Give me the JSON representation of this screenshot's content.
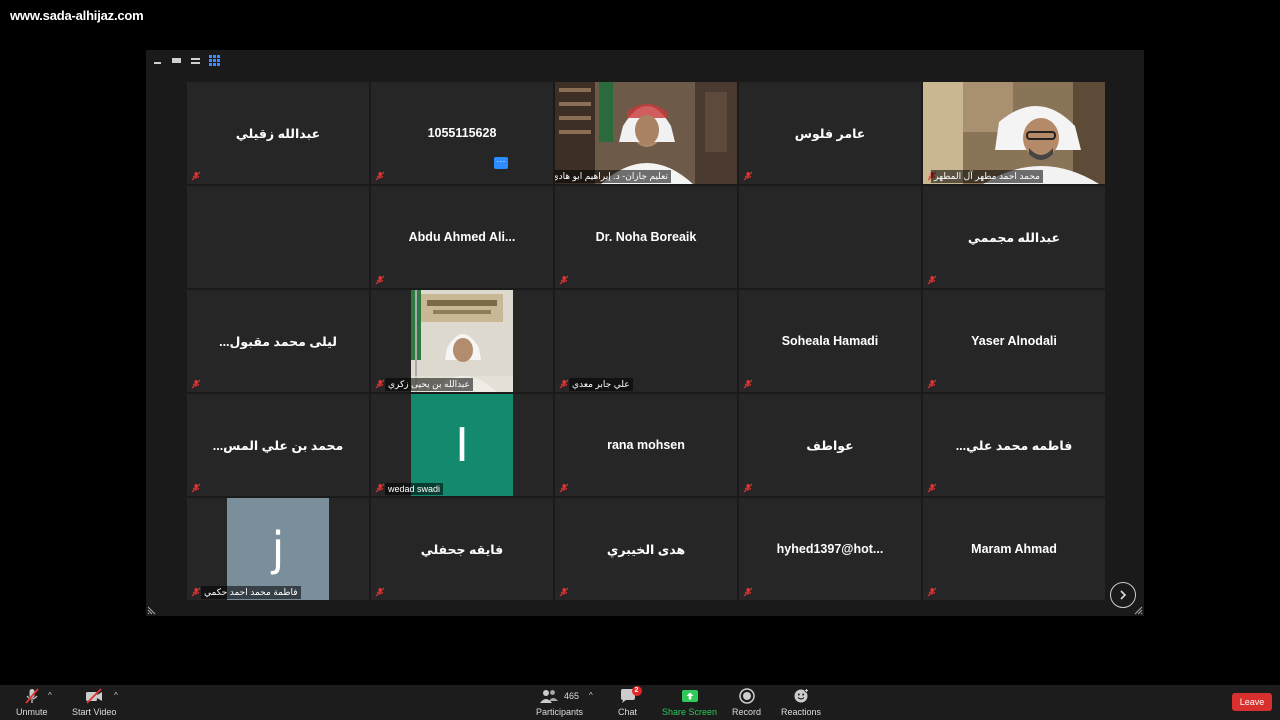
{
  "watermark": "www.sada-alhijaz.com",
  "tiles": [
    {
      "name": "عبدالله زقيلي",
      "muted": true
    },
    {
      "name": "1055115628",
      "muted": true
    },
    {
      "caption": "تعليم جازان- د. إبراهيم ابو هادي",
      "muted": false,
      "video": true
    },
    {
      "name": "عامر فلوس",
      "muted": true
    },
    {
      "caption": "محمد احمد مطهر آل المطهر",
      "muted": true,
      "video": true
    },
    {
      "name": "",
      "muted": false
    },
    {
      "name": "Abdu  Ahmed  Ali...",
      "muted": true
    },
    {
      "name": "Dr. Noha Boreaik",
      "muted": true
    },
    {
      "name": "",
      "muted": false
    },
    {
      "name": "عبدالله مجممي",
      "muted": true
    },
    {
      "name": "ليلى محمد مقبول...",
      "muted": true
    },
    {
      "caption": "عبدالله بن يحيى زكري",
      "muted": true,
      "video": true
    },
    {
      "caption": "علي جابر معدي",
      "muted": true
    },
    {
      "name": "Soheala Hamadi",
      "muted": true
    },
    {
      "name": "Yaser Alnodali",
      "muted": true
    },
    {
      "name": "محمد بن علي المس...",
      "muted": true
    },
    {
      "caption": "wedad swadi",
      "muted": true,
      "avatar": "I"
    },
    {
      "name": "rana mohsen",
      "muted": true
    },
    {
      "name": "عواطف",
      "muted": true
    },
    {
      "name": "فاطمه محمد علي...",
      "muted": true
    },
    {
      "caption": "فاطمة محمد احمد حكمي",
      "muted": true,
      "avatar": "j"
    },
    {
      "name": "فايقه جحفلي",
      "muted": true
    },
    {
      "name": "هدى الخيبري",
      "muted": true
    },
    {
      "name": "hyhed1397@hot...",
      "muted": true
    },
    {
      "name": "Maram Ahmad",
      "muted": true
    }
  ],
  "toolbar": {
    "unmute": "Unmute",
    "start_video": "Start Video",
    "participants": "Participants",
    "participants_count": "465",
    "chat": "Chat",
    "chat_badge": "2",
    "share_screen": "Share Screen",
    "record": "Record",
    "reactions": "Reactions",
    "leave": "Leave"
  },
  "colors": {
    "active_speaker": "#e6e34a",
    "share_green": "#2fc95a",
    "leave_red": "#d8302f",
    "accent_blue": "#2d8cff",
    "avatar_teal": "#138a6e",
    "avatar_slate": "#7a8e9c"
  },
  "icons": [
    "view-minimize-icon",
    "view-speaker-icon",
    "view-gallery-icon",
    "view-grid-icon",
    "mic-muted-icon",
    "video-off-icon",
    "participants-icon",
    "chat-icon",
    "share-screen-icon",
    "record-icon",
    "reactions-icon",
    "next-page-icon"
  ]
}
